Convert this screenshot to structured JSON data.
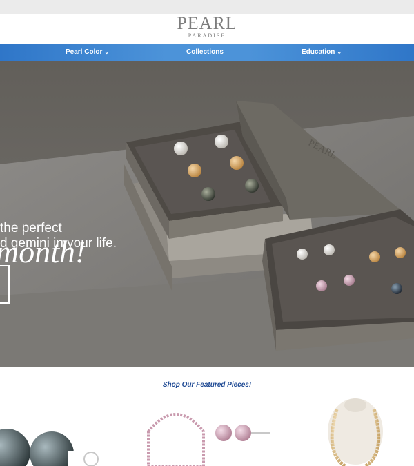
{
  "logo": {
    "main": "PEARL",
    "sub": "PARADISE"
  },
  "nav": {
    "items": [
      {
        "label": "Pearl Color",
        "has_dropdown": true
      },
      {
        "label": "Collections",
        "has_dropdown": false
      },
      {
        "label": "Education",
        "has_dropdown": true
      }
    ]
  },
  "hero": {
    "headline": "month!",
    "line1": "the perfect",
    "line2": "d gemini in your life.",
    "box_lid_brand": "PEARL"
  },
  "featured": {
    "title": "Shop Our Featured Pieces!"
  },
  "colors": {
    "nav_blue": "#3a84d1",
    "featured_text": "#1f4a94",
    "hero_bg": "#6a6864"
  }
}
